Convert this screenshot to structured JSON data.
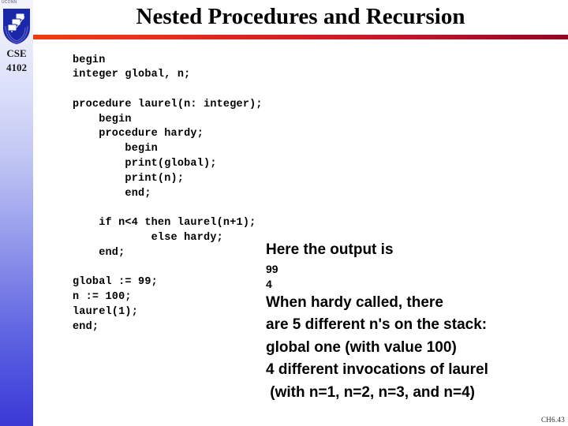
{
  "slide": {
    "title": "Nested Procedures and Recursion",
    "footer": "CH6.43",
    "accent_bar_left_color": "#ef3b12",
    "accent_bar_right_color": "#8e0722",
    "sidebar_top_color": "#f4f5fc",
    "sidebar_bottom_color": "#3b38d4"
  },
  "sidebar": {
    "wordmark": "UCONN",
    "logo_icon": "shield-computers-icon",
    "course_code": "CSE",
    "course_number": "4102"
  },
  "code": {
    "language": "pascal-like pseudocode",
    "lines": [
      "begin",
      "integer global, n;",
      "",
      "procedure laurel(n: integer);",
      "    begin",
      "    procedure hardy;",
      "        begin",
      "        print(global);",
      "        print(n);",
      "        end;",
      "",
      "    if n<4 then laurel(n+1);",
      "            else hardy;",
      "    end;",
      "",
      "global := 99;",
      "n := 100;",
      "laurel(1);",
      "end;"
    ],
    "text": "begin\ninteger global, n;\n\nprocedure laurel(n: integer);\n    begin\n    procedure hardy;\n        begin\n        print(global);\n        print(n);\n        end;\n\n    if n<4 then laurel(n+1);\n            else hardy;\n    end;\n\nglobal := 99;\nn := 100;\nlaurel(1);\nend;"
  },
  "notes": {
    "heading": "Here the output is",
    "output_values": "99\n4",
    "output_value_1": "99",
    "output_value_2": "4",
    "explanation_lines": [
      "When hardy called, there",
      "are 5 different n's on the stack:",
      "global one (with value 100)",
      "4 different invocations of laurel",
      " (with n=1, n=2, n=3, and n=4)"
    ],
    "explanation_text": "When hardy called, there\nare 5 different n's on the stack:\nglobal one (with value 100)\n4 different invocations of laurel\n (with n=1, n=2, n=3, and n=4)"
  }
}
